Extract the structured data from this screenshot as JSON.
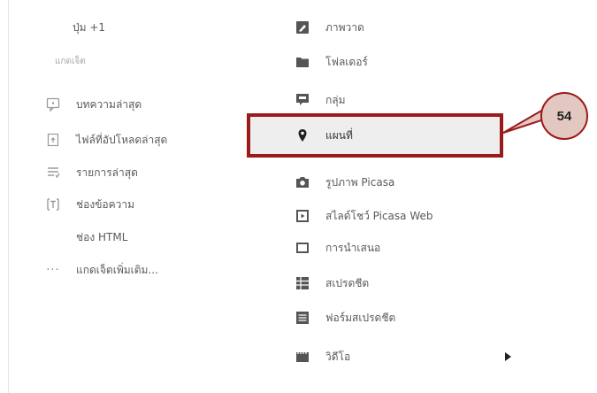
{
  "left_menu": {
    "plus_one": "ปุ่ม +1",
    "section_label": "แกดเจ็ต",
    "items": [
      {
        "label": "บทความล่าสุด",
        "icon": "comment-icon"
      },
      {
        "label": "ไฟล์ที่อัปโหลดล่าสุด",
        "icon": "upload-file-icon"
      },
      {
        "label": "รายการล่าสุด",
        "icon": "list-icon"
      },
      {
        "label": "ช่องข้อความ",
        "icon": "text-box-icon"
      },
      {
        "label": "ช่อง HTML",
        "icon": ""
      },
      {
        "label": "แกดเจ็ตเพิ่มเติม...",
        "icon": "more-dots-icon"
      }
    ]
  },
  "right_menu": {
    "items": [
      {
        "label": "ภาพวาด",
        "icon": "drawing-icon"
      },
      {
        "label": "โฟลเดอร์",
        "icon": "folder-icon"
      },
      {
        "label": "กลุ่ม",
        "icon": "group-comment-icon"
      },
      {
        "label": "แผนที่",
        "icon": "map-pin-icon",
        "selected": true
      },
      {
        "label": "รูปภาพ Picasa",
        "icon": "camera-icon"
      },
      {
        "label": "สไลด์โชว์ Picasa Web",
        "icon": "slideshow-icon"
      },
      {
        "label": "การนำเสนอ",
        "icon": "presentation-icon"
      },
      {
        "label": "สเปรดชีต",
        "icon": "spreadsheet-icon"
      },
      {
        "label": "ฟอร์มสเปรดชีต",
        "icon": "form-icon"
      },
      {
        "label": "วิดีโอ",
        "icon": "video-icon",
        "has_submenu": true
      }
    ]
  },
  "callout": {
    "number": "54",
    "highlight_color": "#9b1b1b",
    "badge_fill": "#e3c8c2"
  }
}
